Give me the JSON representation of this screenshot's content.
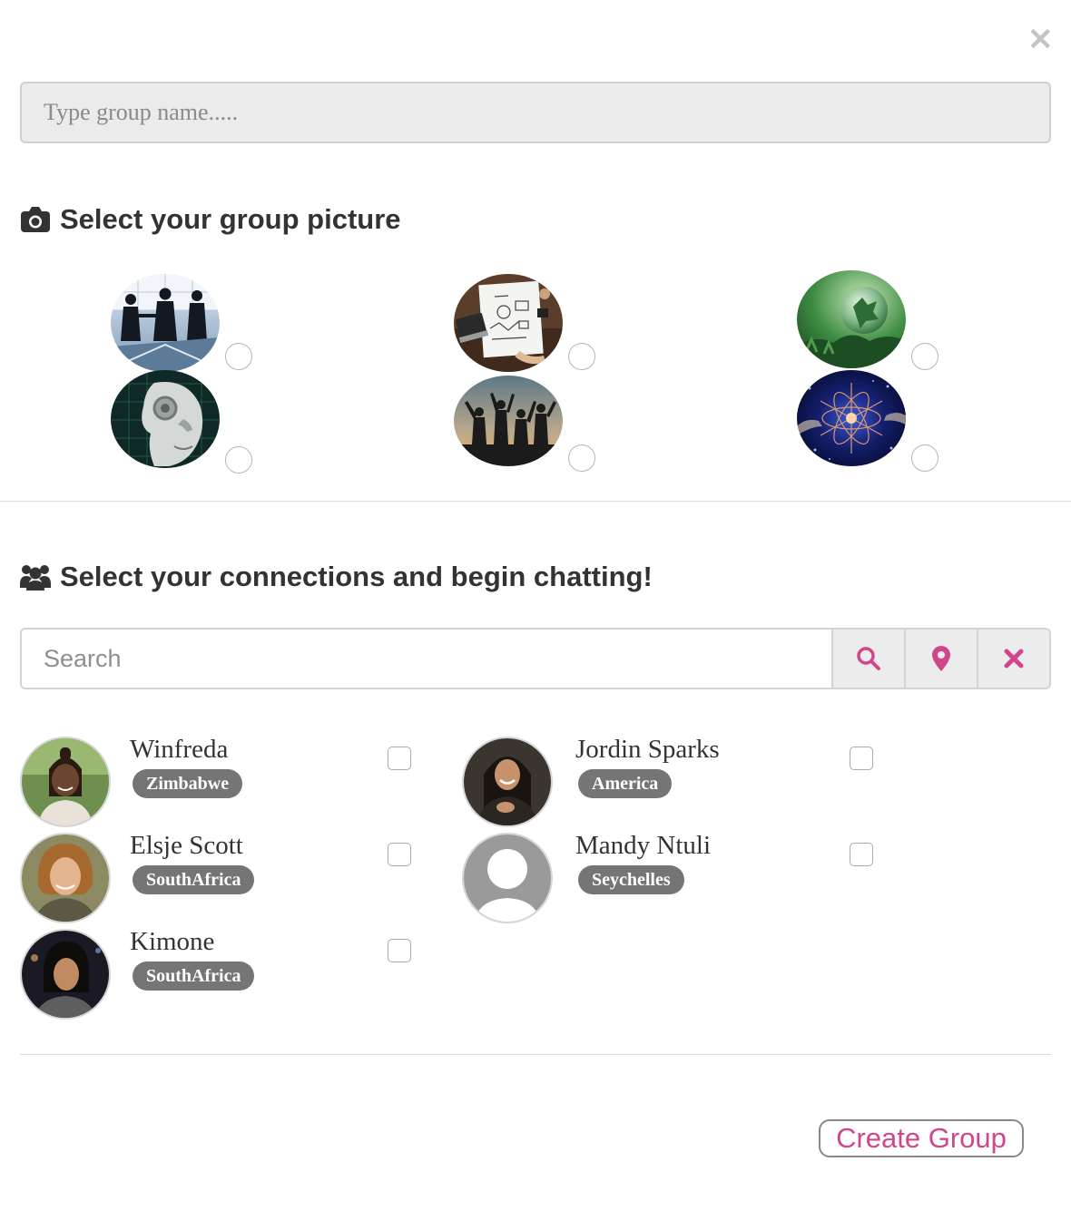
{
  "dialog": {
    "close_icon": "close-icon"
  },
  "group_name": {
    "placeholder": "Type group name....."
  },
  "picture_section": {
    "title": "Select your group picture",
    "icon": "camera-icon",
    "options": [
      {
        "name": "business-handshake",
        "selected": false
      },
      {
        "name": "desk-planning",
        "selected": false
      },
      {
        "name": "green-globe",
        "selected": false
      },
      {
        "name": "robot-head",
        "selected": false
      },
      {
        "name": "people-silhouettes",
        "selected": false
      },
      {
        "name": "tech-network",
        "selected": false
      }
    ]
  },
  "connections_section": {
    "title": "Select your connections and begin chatting!",
    "icon": "users-icon"
  },
  "search": {
    "placeholder": "Search",
    "buttons": [
      "search-icon",
      "map-marker-icon",
      "clear-icon"
    ],
    "accent_color": "#d1468a"
  },
  "contacts": [
    {
      "name": "Winfreda",
      "country": "Zimbabwe",
      "checked": false
    },
    {
      "name": "Jordin Sparks",
      "country": "America",
      "checked": false
    },
    {
      "name": "Elsje Scott",
      "country": "SouthAfrica",
      "checked": false
    },
    {
      "name": "Mandy Ntuli",
      "country": "Seychelles",
      "checked": false
    },
    {
      "name": "Kimone",
      "country": "SouthAfrica",
      "checked": false
    }
  ],
  "actions": {
    "create_label": "Create Group"
  }
}
